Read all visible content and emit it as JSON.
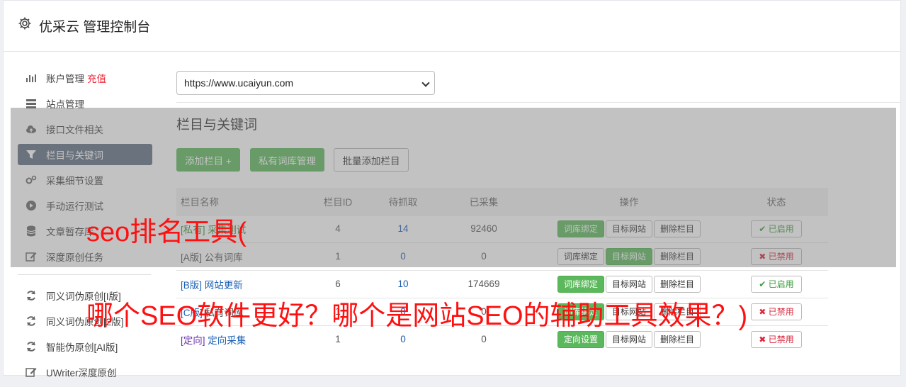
{
  "header": {
    "title": "优采云 管理控制台"
  },
  "sidebar": {
    "items": [
      {
        "label": "账户管理",
        "extra": "充值",
        "icon": "bar-chart-icon"
      },
      {
        "label": "站点管理",
        "icon": "server-icon"
      },
      {
        "label": "接口文件相关",
        "icon": "cloud-upload-icon"
      },
      {
        "label": "栏目与关键词",
        "icon": "filter-icon",
        "active": true
      },
      {
        "label": "采集细节设置",
        "icon": "gears-icon"
      },
      {
        "label": "手动运行测试",
        "icon": "play-circle-icon"
      },
      {
        "label": "文章暂存库",
        "icon": "database-icon"
      },
      {
        "label": "深度原创任务",
        "icon": "edit-icon"
      }
    ],
    "items2": [
      {
        "label": "同义词伪原创[I版]",
        "icon": "refresh-icon"
      },
      {
        "label": "同义词伪原创[2版]",
        "icon": "refresh-icon"
      },
      {
        "label": "智能伪原创[AI版]",
        "icon": "refresh-icon"
      },
      {
        "label": "UWriter深度原创",
        "icon": "edit-icon"
      }
    ]
  },
  "site_select": {
    "value": "https://www.ucaiyun.com"
  },
  "section": {
    "title": "栏目与关键词"
  },
  "toolbar": {
    "add_label": "添加栏目 +",
    "private_label": "私有词库管理",
    "batch_label": "批量添加栏目"
  },
  "table": {
    "headers": [
      "栏目名称",
      "栏目ID",
      "待抓取",
      "已采集",
      "操作",
      "状态"
    ],
    "rows": [
      {
        "tag": "[私有]",
        "name": "采集测试",
        "id": "4",
        "pending": "14",
        "collected": "92460",
        "op1": "词库绑定",
        "op2": "目标网站",
        "op3": "删除栏目",
        "status": "已启用",
        "on": true,
        "op1g": true,
        "op2g": false
      },
      {
        "tag": "[A版]",
        "name": "公有词库",
        "id": "1",
        "pending": "0",
        "collected": "0",
        "op1": "词库绑定",
        "op2": "目标网站",
        "op3": "删除栏目",
        "status": "已禁用",
        "on": false,
        "op1g": false,
        "op2g": true
      },
      {
        "tag": "[B版]",
        "name": "网站更新",
        "id": "6",
        "pending": "10",
        "collected": "174669",
        "op1": "词库绑定",
        "op2": "目标网站",
        "op3": "删除栏目",
        "status": "已启用",
        "on": true,
        "op1g": true,
        "op2g": false
      },
      {
        "tag": "[C版]",
        "name": "私有词库",
        "id": "1",
        "pending": "0",
        "collected": "0",
        "op1": "词库绑定",
        "op2": "目标网站",
        "op3": "删除栏目",
        "status": "已禁用",
        "on": false,
        "op1g": true,
        "op2g": false
      },
      {
        "tag": "[定向]",
        "name": "定向采集",
        "id": "1",
        "pending": "0",
        "collected": "0",
        "op1": "定向设置",
        "op2": "目标网站",
        "op3": "删除栏目",
        "status": "已禁用",
        "on": false,
        "op1g": true,
        "op2g": false
      }
    ]
  },
  "overlay_text": {
    "line1": "seo排名工具(",
    "line2": "哪个SEO软件更好？哪个是网站SEO的辅助工具效果？)"
  }
}
